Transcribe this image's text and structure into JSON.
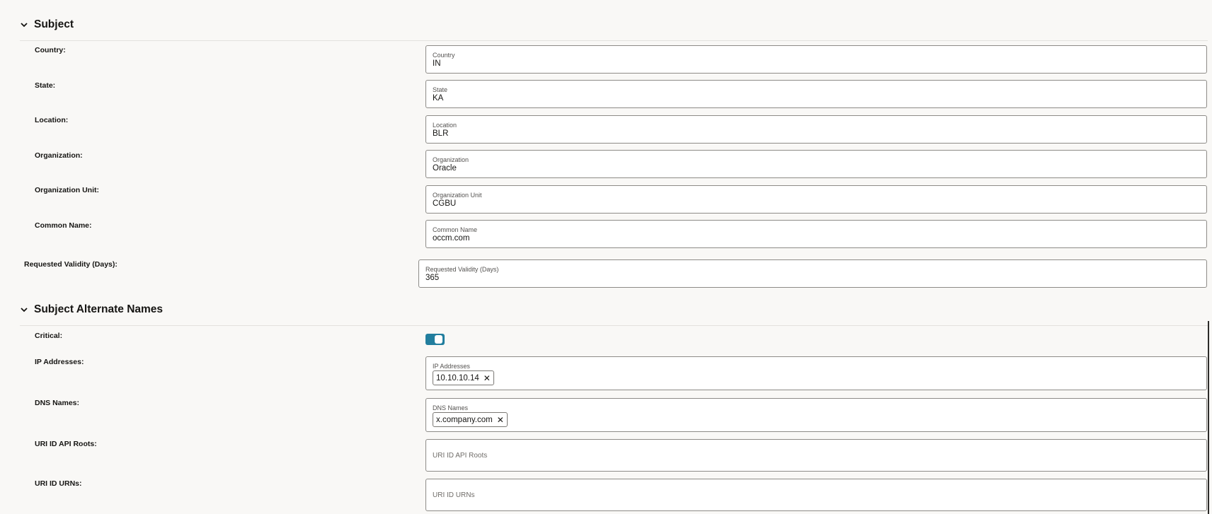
{
  "subject": {
    "title": "Subject",
    "fields": [
      {
        "row_label": "Country:",
        "field_label": "Country",
        "value": "IN"
      },
      {
        "row_label": "State:",
        "field_label": "State",
        "value": "KA"
      },
      {
        "row_label": "Location:",
        "field_label": "Location",
        "value": "BLR"
      },
      {
        "row_label": "Organization:",
        "field_label": "Organization",
        "value": "Oracle"
      },
      {
        "row_label": "Organization Unit:",
        "field_label": "Organization Unit",
        "value": "CGBU"
      },
      {
        "row_label": "Common Name:",
        "field_label": "Common Name",
        "value": "occm.com"
      }
    ]
  },
  "validity": {
    "row_label": "Requested Validity (Days):",
    "field_label": "Requested Validity (Days)",
    "value": "365"
  },
  "san": {
    "title": "Subject Alternate Names",
    "critical": {
      "row_label": "Critical:",
      "enabled": true
    },
    "ip": {
      "row_label": "IP Addresses:",
      "field_label": "IP Addresses",
      "chips": [
        "10.10.10.14"
      ]
    },
    "dns": {
      "row_label": "DNS Names:",
      "field_label": "DNS Names",
      "chips": [
        "x.company.com"
      ]
    },
    "uri_roots": {
      "row_label": "URI ID API Roots:",
      "placeholder": "URI ID API Roots"
    },
    "uri_urns": {
      "row_label": "URI ID URNs:",
      "placeholder": "URI ID URNs"
    }
  },
  "icons": {
    "collapse": "chevron-down-icon",
    "remove": "close-icon"
  },
  "colors": {
    "toggle_on": "#227e9e",
    "background": "#f9f8f6",
    "border": "#8d8b87"
  }
}
